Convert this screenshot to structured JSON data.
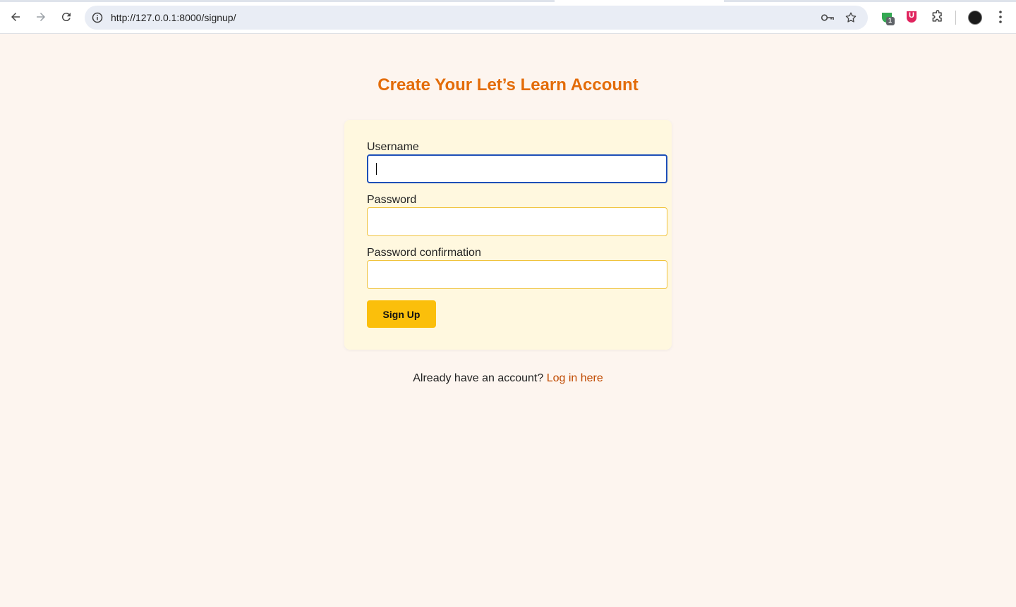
{
  "browser": {
    "url": "http://127.0.0.1:8000/signup/",
    "extension_badge": "1",
    "extension_letter": "U",
    "icons": [
      "back-arrow-icon",
      "forward-arrow-icon",
      "reload-icon",
      "site-info-icon",
      "password-key-icon",
      "bookmark-star-icon",
      "extension-shield-icon",
      "extension-u-icon",
      "extensions-puzzle-icon",
      "profile-avatar",
      "kebab-menu-icon"
    ]
  },
  "page": {
    "title": "Create Your Let’s Learn Account",
    "form": {
      "username_label": "Username",
      "username_value": "",
      "password_label": "Password",
      "password_value": "",
      "password_confirm_label": "Password confirmation",
      "password_confirm_value": "",
      "submit_label": "Sign Up"
    },
    "footer": {
      "text": "Already have an account?",
      "link_label": "Log in here"
    }
  },
  "colors": {
    "title": "#e36c09",
    "card_bg": "#fff8df",
    "page_bg": "#fdf5ef",
    "button_bg": "#fbbf0b",
    "link": "#c04a00",
    "focus_border": "#1d4fb8",
    "input_border": "#f0c33c"
  }
}
